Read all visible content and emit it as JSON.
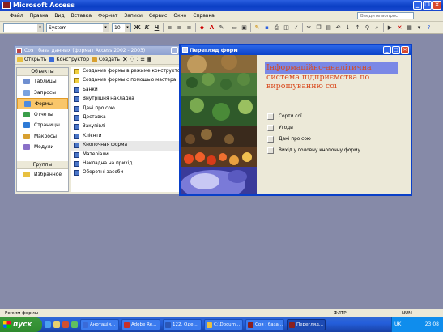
{
  "app": {
    "title": "Microsoft Access",
    "ask_placeholder": "Введите вопрос"
  },
  "menu": [
    "Файл",
    "Правка",
    "Вид",
    "Вставка",
    "Формат",
    "Записи",
    "Сервис",
    "Окно",
    "Справка"
  ],
  "toolbar": {
    "font": "System",
    "size": "10",
    "bold": "Ж",
    "italic": "К",
    "underline": "Ч"
  },
  "db_window": {
    "title": "Соя : база данных (формат Access 2002 - 2003)",
    "toolbar": {
      "open": "Открыть",
      "design": "Конструктор",
      "create": "Создать"
    },
    "objects_header": "Объекты",
    "objects": [
      {
        "label": "Таблицы",
        "color": "#6f8fd0"
      },
      {
        "label": "Запросы",
        "color": "#7aa3e0"
      },
      {
        "label": "Формы",
        "color": "#4c8be0",
        "selected": true
      },
      {
        "label": "Отчеты",
        "color": "#3a9e4a"
      },
      {
        "label": "Страницы",
        "color": "#2e7bd6"
      },
      {
        "label": "Макросы",
        "color": "#d8a030"
      },
      {
        "label": "Модули",
        "color": "#8a70c8"
      }
    ],
    "groups_header": "Группы",
    "favorites": "Избранное",
    "forms": [
      "Создание формы в режиме конструктора",
      "Создание формы с помощью мастера",
      "Банки",
      "Внутрішня накладна",
      "Дані про сою",
      "Доставка",
      "Закупівлі",
      "Клієнти",
      "Кнопочная форма",
      "Матеріали",
      "Накладна на прихід",
      "Оборотні засоби"
    ],
    "selected_form": "Кнопочная форма"
  },
  "form_window": {
    "title": "Перегляд форм",
    "heading_line1": "Інформаційно-аналітична",
    "heading_line2": "система підприємства по",
    "heading_line3": "вирощуванню сої",
    "buttons": [
      "Сорти сої",
      "Угоди",
      "Дані про сою",
      "Вихід у головну кнопочну форму"
    ]
  },
  "status": {
    "left": "Режим формы",
    "mid": "ФЛТР",
    "right": "NUM"
  },
  "taskbar": {
    "start": "пуск",
    "tasks": [
      {
        "label": "Анотація...",
        "color": "#3a6ad8"
      },
      {
        "label": "Adobe Re...",
        "color": "#c83028"
      },
      {
        "label": "122. Оде...",
        "color": "#2b57b8"
      },
      {
        "label": "C:\\Docum...",
        "color": "#e8c040"
      },
      {
        "label": "Соя : база...",
        "color": "#8a2020"
      },
      {
        "label": "Перегляд...",
        "color": "#8a2020",
        "active": true
      }
    ],
    "lang": "UK",
    "clock": "23:08"
  }
}
